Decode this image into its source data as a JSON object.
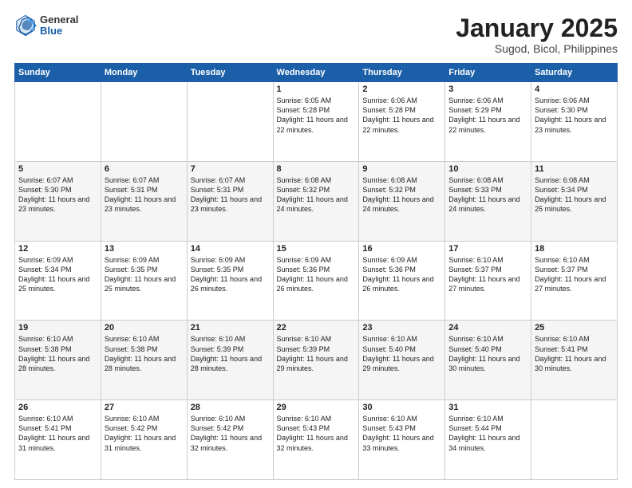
{
  "header": {
    "logo_general": "General",
    "logo_blue": "Blue",
    "month_title": "January 2025",
    "location": "Sugod, Bicol, Philippines"
  },
  "weekdays": [
    "Sunday",
    "Monday",
    "Tuesday",
    "Wednesday",
    "Thursday",
    "Friday",
    "Saturday"
  ],
  "weeks": [
    [
      {
        "day": "",
        "info": ""
      },
      {
        "day": "",
        "info": ""
      },
      {
        "day": "",
        "info": ""
      },
      {
        "day": "1",
        "info": "Sunrise: 6:05 AM\nSunset: 5:28 PM\nDaylight: 11 hours\nand 22 minutes."
      },
      {
        "day": "2",
        "info": "Sunrise: 6:06 AM\nSunset: 5:28 PM\nDaylight: 11 hours\nand 22 minutes."
      },
      {
        "day": "3",
        "info": "Sunrise: 6:06 AM\nSunset: 5:29 PM\nDaylight: 11 hours\nand 22 minutes."
      },
      {
        "day": "4",
        "info": "Sunrise: 6:06 AM\nSunset: 5:30 PM\nDaylight: 11 hours\nand 23 minutes."
      }
    ],
    [
      {
        "day": "5",
        "info": "Sunrise: 6:07 AM\nSunset: 5:30 PM\nDaylight: 11 hours\nand 23 minutes."
      },
      {
        "day": "6",
        "info": "Sunrise: 6:07 AM\nSunset: 5:31 PM\nDaylight: 11 hours\nand 23 minutes."
      },
      {
        "day": "7",
        "info": "Sunrise: 6:07 AM\nSunset: 5:31 PM\nDaylight: 11 hours\nand 23 minutes."
      },
      {
        "day": "8",
        "info": "Sunrise: 6:08 AM\nSunset: 5:32 PM\nDaylight: 11 hours\nand 24 minutes."
      },
      {
        "day": "9",
        "info": "Sunrise: 6:08 AM\nSunset: 5:32 PM\nDaylight: 11 hours\nand 24 minutes."
      },
      {
        "day": "10",
        "info": "Sunrise: 6:08 AM\nSunset: 5:33 PM\nDaylight: 11 hours\nand 24 minutes."
      },
      {
        "day": "11",
        "info": "Sunrise: 6:08 AM\nSunset: 5:34 PM\nDaylight: 11 hours\nand 25 minutes."
      }
    ],
    [
      {
        "day": "12",
        "info": "Sunrise: 6:09 AM\nSunset: 5:34 PM\nDaylight: 11 hours\nand 25 minutes."
      },
      {
        "day": "13",
        "info": "Sunrise: 6:09 AM\nSunset: 5:35 PM\nDaylight: 11 hours\nand 25 minutes."
      },
      {
        "day": "14",
        "info": "Sunrise: 6:09 AM\nSunset: 5:35 PM\nDaylight: 11 hours\nand 26 minutes."
      },
      {
        "day": "15",
        "info": "Sunrise: 6:09 AM\nSunset: 5:36 PM\nDaylight: 11 hours\nand 26 minutes."
      },
      {
        "day": "16",
        "info": "Sunrise: 6:09 AM\nSunset: 5:36 PM\nDaylight: 11 hours\nand 26 minutes."
      },
      {
        "day": "17",
        "info": "Sunrise: 6:10 AM\nSunset: 5:37 PM\nDaylight: 11 hours\nand 27 minutes."
      },
      {
        "day": "18",
        "info": "Sunrise: 6:10 AM\nSunset: 5:37 PM\nDaylight: 11 hours\nand 27 minutes."
      }
    ],
    [
      {
        "day": "19",
        "info": "Sunrise: 6:10 AM\nSunset: 5:38 PM\nDaylight: 11 hours\nand 28 minutes."
      },
      {
        "day": "20",
        "info": "Sunrise: 6:10 AM\nSunset: 5:38 PM\nDaylight: 11 hours\nand 28 minutes."
      },
      {
        "day": "21",
        "info": "Sunrise: 6:10 AM\nSunset: 5:39 PM\nDaylight: 11 hours\nand 28 minutes."
      },
      {
        "day": "22",
        "info": "Sunrise: 6:10 AM\nSunset: 5:39 PM\nDaylight: 11 hours\nand 29 minutes."
      },
      {
        "day": "23",
        "info": "Sunrise: 6:10 AM\nSunset: 5:40 PM\nDaylight: 11 hours\nand 29 minutes."
      },
      {
        "day": "24",
        "info": "Sunrise: 6:10 AM\nSunset: 5:40 PM\nDaylight: 11 hours\nand 30 minutes."
      },
      {
        "day": "25",
        "info": "Sunrise: 6:10 AM\nSunset: 5:41 PM\nDaylight: 11 hours\nand 30 minutes."
      }
    ],
    [
      {
        "day": "26",
        "info": "Sunrise: 6:10 AM\nSunset: 5:41 PM\nDaylight: 11 hours\nand 31 minutes."
      },
      {
        "day": "27",
        "info": "Sunrise: 6:10 AM\nSunset: 5:42 PM\nDaylight: 11 hours\nand 31 minutes."
      },
      {
        "day": "28",
        "info": "Sunrise: 6:10 AM\nSunset: 5:42 PM\nDaylight: 11 hours\nand 32 minutes."
      },
      {
        "day": "29",
        "info": "Sunrise: 6:10 AM\nSunset: 5:43 PM\nDaylight: 11 hours\nand 32 minutes."
      },
      {
        "day": "30",
        "info": "Sunrise: 6:10 AM\nSunset: 5:43 PM\nDaylight: 11 hours\nand 33 minutes."
      },
      {
        "day": "31",
        "info": "Sunrise: 6:10 AM\nSunset: 5:44 PM\nDaylight: 11 hours\nand 34 minutes."
      },
      {
        "day": "",
        "info": ""
      }
    ]
  ]
}
